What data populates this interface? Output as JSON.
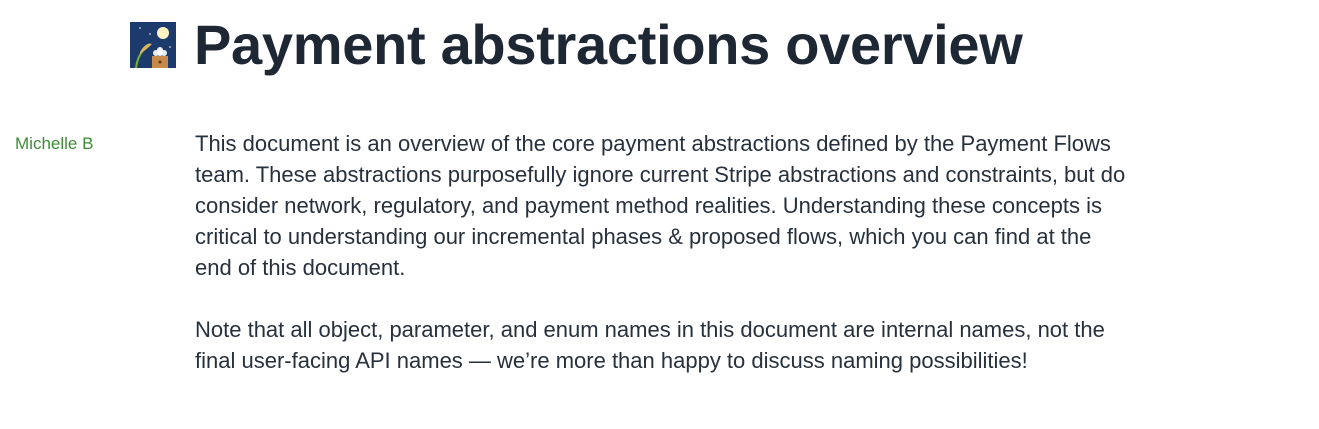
{
  "doc": {
    "title": "Payment abstractions overview",
    "title_icon": "moon-viewing-ceremony-icon",
    "author": "Michelle B",
    "paragraphs": [
      [
        "This document is an overview of the core payment abstractions defined by the Payment Flows",
        "team. These abstractions purposefully ignore current Stripe abstractions and constraints, but do",
        "consider network, regulatory, and payment method realities. Understanding these concepts is",
        "critical to understanding our incremental phases & proposed flows, which you can find at the",
        "end of this document."
      ],
      [
        "Note that all object, parameter, and enum names in this document are internal names, not the",
        "final user-facing API names — we’re more than happy to discuss naming possibilities!"
      ]
    ]
  }
}
